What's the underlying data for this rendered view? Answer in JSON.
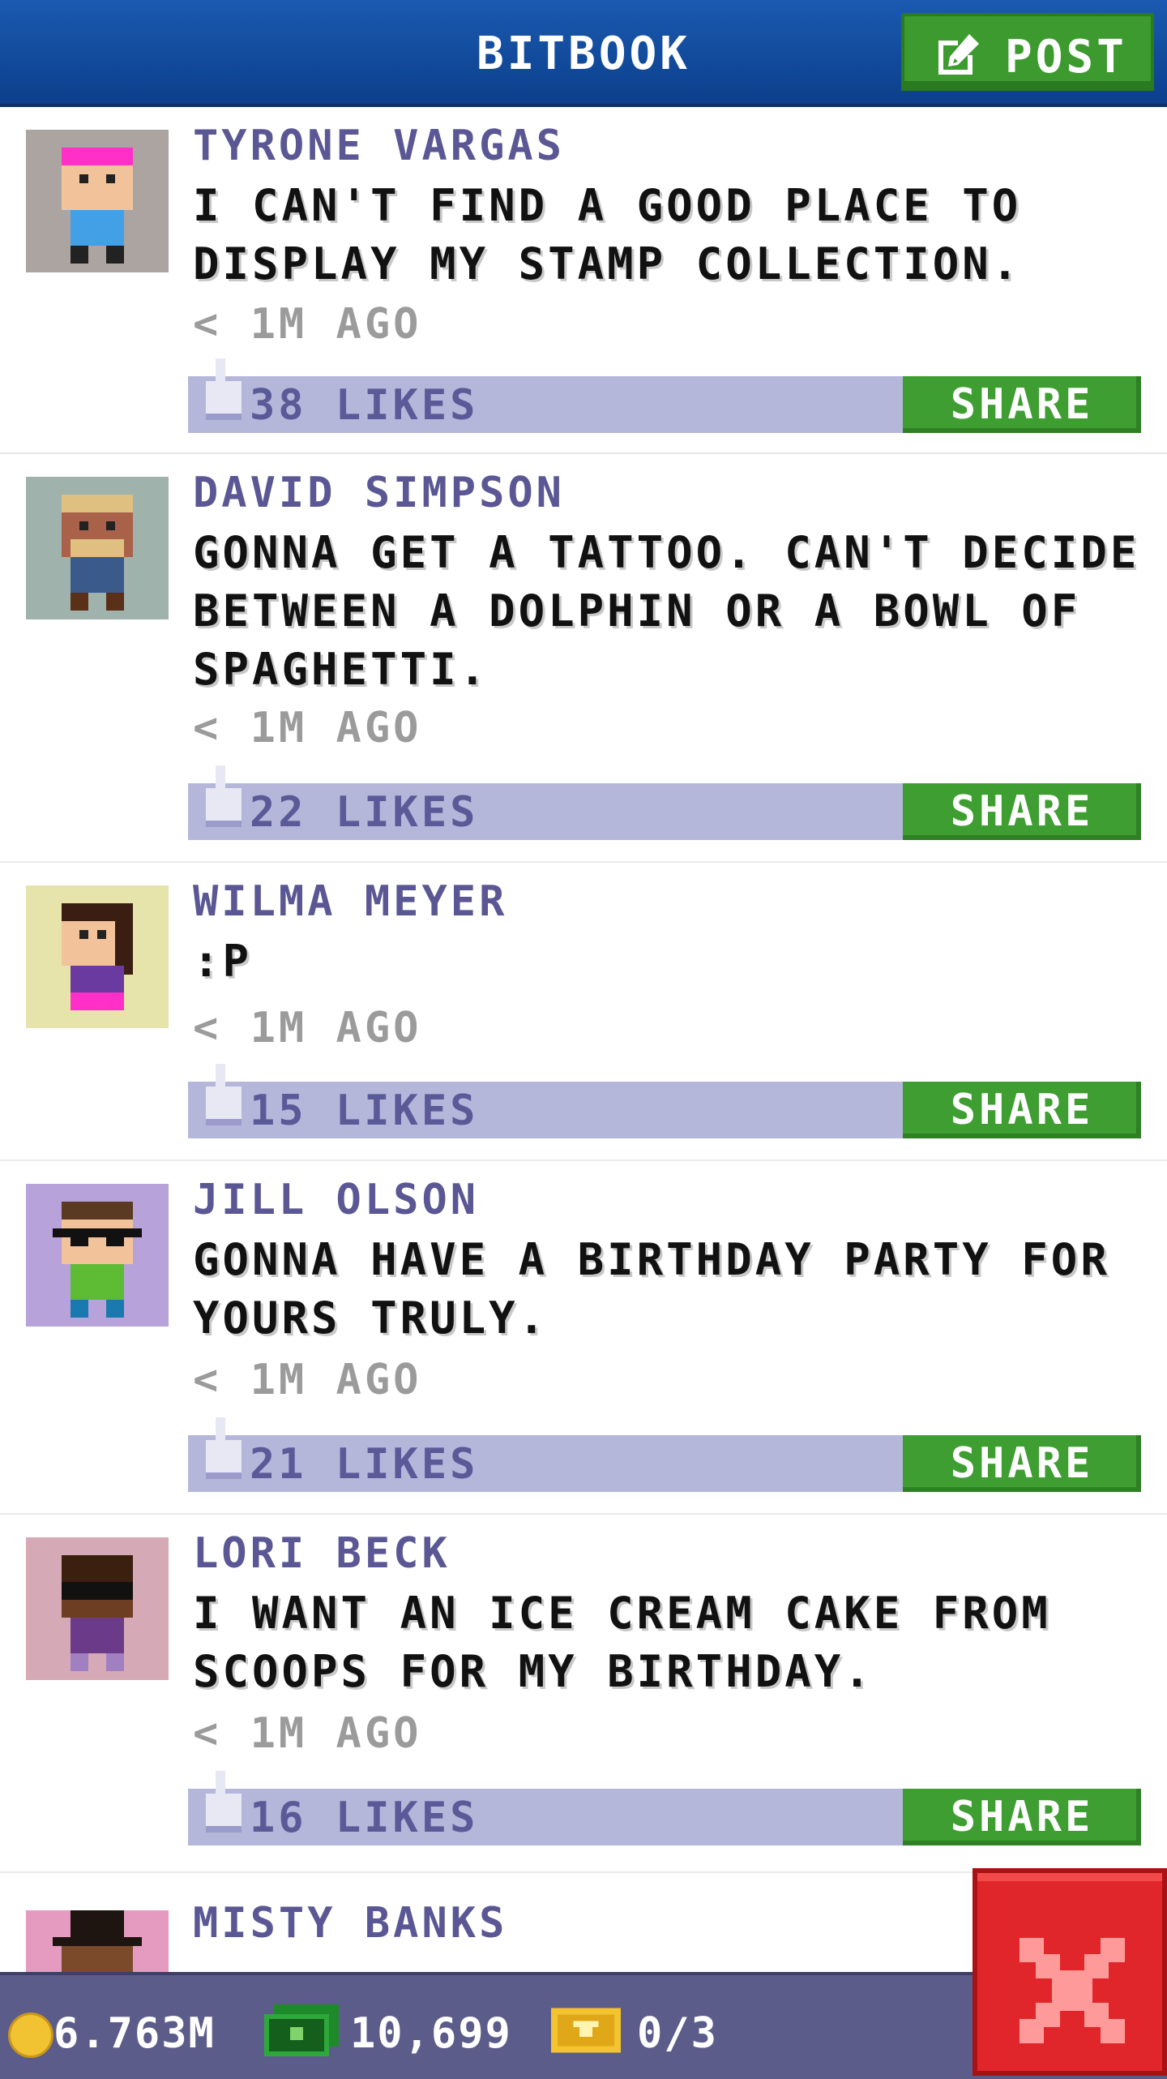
{
  "header": {
    "title": "BITBOOK",
    "post_label": "POST"
  },
  "posts": [
    {
      "name": "TYRONE VARGAS",
      "message": "I CAN'T FIND A GOOD PLACE TO DISPLAY MY STAMP COLLECTION.",
      "time": "< 1M AGO",
      "likes": "38 LIKES",
      "share": "SHARE",
      "avatar_bg": "#aba4a1",
      "skin": "#f2c39b",
      "hair": "#ff2fc8",
      "shirt": "#41a0e6"
    },
    {
      "name": "DAVID SIMPSON",
      "message": "GONNA GET A TATTOO. CAN'T DECIDE BETWEEN A DOLPHIN OR A BOWL OF SPAGHETTI.",
      "time": "< 1M AGO",
      "likes": "22 LIKES",
      "share": "SHARE",
      "avatar_bg": "#9fb3ac",
      "skin": "#a9614a",
      "hair": "#e0c080",
      "shirt": "#3a5a8c"
    },
    {
      "name": "WILMA MEYER",
      "message": ":P",
      "time": "< 1M AGO",
      "likes": "15 LIKES",
      "share": "SHARE",
      "avatar_bg": "#e6e3ab",
      "skin": "#f2c39b",
      "hair": "#3b1e12",
      "shirt": "#6b3aa0"
    },
    {
      "name": "JILL OLSON",
      "message": "GONNA HAVE A BIRTHDAY PARTY FOR YOURS TRULY.",
      "time": "< 1M AGO",
      "likes": "21 LIKES",
      "share": "SHARE",
      "avatar_bg": "#b7a2d9",
      "skin": "#f2c39b",
      "hair": "#5a3a22",
      "shirt": "#5dbb34"
    },
    {
      "name": "LORI BECK",
      "message": "I WANT AN ICE CREAM CAKE FROM SCOOPS FOR MY BIRTHDAY.",
      "time": "< 1M AGO",
      "likes": "16 LIKES",
      "share": "SHARE",
      "avatar_bg": "#d6a9b6",
      "skin": "#6e3e22",
      "hair": "#3b2010",
      "shirt": "#6b3a88"
    },
    {
      "name": "MISTY BANKS",
      "message": "",
      "time": "",
      "likes": "",
      "share": "",
      "avatar_bg": "#e59ac0",
      "skin": "#7a4a2a",
      "hair": "#1e1410",
      "shirt": "#333333"
    }
  ],
  "status_bar": {
    "coins": "6.763M",
    "bux": "10,699",
    "tickets": "0/3"
  },
  "colors": {
    "header": "#1a5ab0",
    "share_green": "#3f9e31",
    "like_bar": "#b4b7d9",
    "name_purple": "#5a5794",
    "close_red": "#e0262a"
  }
}
